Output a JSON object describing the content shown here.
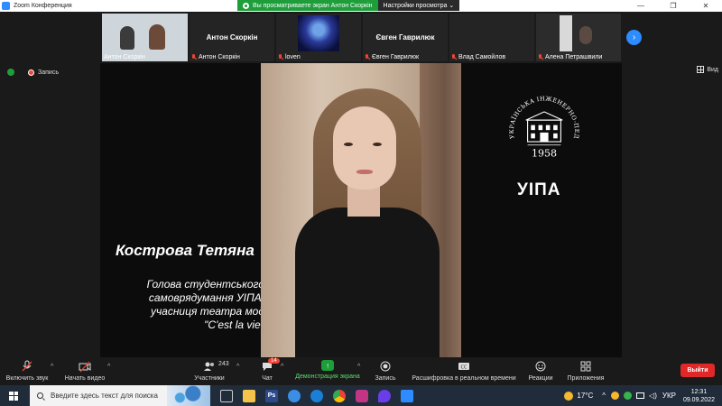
{
  "window": {
    "title": "Zoom Конференция",
    "controls": [
      "—",
      "❐",
      "✕"
    ]
  },
  "share_banner": {
    "status": "Вы просматриваете экран Антон Скоркін",
    "view_options": "Настройки просмотра ⌄"
  },
  "participants": [
    {
      "name": "Антон Скоркін",
      "type": "video"
    },
    {
      "name": "Антон Скоркін",
      "type": "name",
      "display": "Антон Скоркін"
    },
    {
      "name": "loven",
      "type": "image"
    },
    {
      "name": "Євген Гаврилюк",
      "type": "name",
      "display": "Євген Гаврилюк"
    },
    {
      "name": "Влад Самойлов",
      "type": "blank"
    },
    {
      "name": "Алена Петрашвили",
      "type": "video"
    }
  ],
  "status_row": {
    "record_label": "Запись",
    "view_label": "Вид"
  },
  "shared_content": {
    "person_name": "Кострова Тетяна",
    "person_desc": [
      "Голова студентського",
      "самоврядумання УІПА,",
      "учасниця театра мод",
      "\"C'est la vie\""
    ],
    "logo_year": "1958",
    "logo_arc_text": "УКРАЇНСЬКА ІНЖЕНЕРНО-ПЕДАГОГІЧНА АКАДЕМІЯ",
    "logo_abbr": "УІПА"
  },
  "toolbar": {
    "audio": "Включить звук",
    "video": "Начать видео",
    "participants_label": "Участники",
    "participants_count": "243",
    "chat_label": "Чат",
    "chat_badge": "14",
    "share": "Демонстрация экрана",
    "record": "Запись",
    "transcript": "Расшифровка в реальном времени",
    "reactions": "Реакции",
    "apps": "Приложения",
    "leave": "Выйти"
  },
  "taskbar": {
    "search_placeholder": "Введите здесь текст для поиска",
    "weather": "17°C",
    "language": "УКР",
    "time": "12:31",
    "date": "09.09.2022"
  },
  "colors": {
    "zoom_blue": "#2d8cff",
    "share_green": "#1e9e3b",
    "leave_red": "#e02828",
    "taskbar": "#212c3a"
  }
}
